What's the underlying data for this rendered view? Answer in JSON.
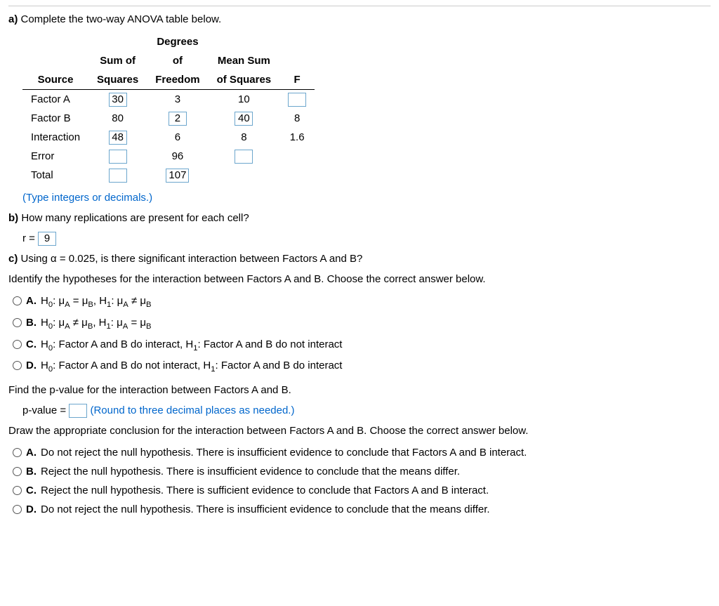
{
  "partA": {
    "prompt_prefix": "a)",
    "prompt_text": " Complete the two-way ANOVA table below.",
    "headers": {
      "source": "Source",
      "ss": "Sum of Squares",
      "ss_line1": "Sum of",
      "ss_line2": "Squares",
      "df": "Degrees of Freedom",
      "df_line1": "Degrees",
      "df_line2": "of",
      "df_line3": "Freedom",
      "ms": "Mean Sum of Squares",
      "ms_line1": "Mean Sum",
      "ms_line2": "of Squares",
      "f": "F"
    },
    "rows": {
      "factorA": {
        "label": "Factor A",
        "ss": "30",
        "df": "3",
        "ms": "10",
        "f": ""
      },
      "factorB": {
        "label": "Factor B",
        "ss": "80",
        "df": "2",
        "ms": "40",
        "f": "8"
      },
      "interaction": {
        "label": "Interaction",
        "ss": "48",
        "df": "6",
        "ms": "8",
        "f": "1.6"
      },
      "error": {
        "label": "Error",
        "ss": "",
        "df": "96",
        "ms": "",
        "f": ""
      },
      "total": {
        "label": "Total",
        "ss": "",
        "df": "107",
        "ms": "",
        "f": ""
      }
    },
    "hint": "(Type integers or decimals.)"
  },
  "partB": {
    "prompt_prefix": "b)",
    "prompt_text": " How many replications are present for each cell?",
    "var": "r = ",
    "value": "9"
  },
  "partC": {
    "prompt_prefix": "c)",
    "prompt_text": " Using α = 0.025, is there significant interaction between Factors A and B?",
    "identify": "Identify the hypotheses for the interaction between Factors A and B. Choose the correct answer below.",
    "options": {
      "A": {
        "label": "A."
      },
      "B": {
        "label": "B."
      },
      "C": {
        "label": "C.",
        "text": ": Factor A and B do interact, ",
        "text2": ": Factor A and B do not interact"
      },
      "D": {
        "label": "D.",
        "text": ": Factor A and B do not interact, ",
        "text2": ": Factor A and B do interact"
      }
    },
    "find_p": "Find the p-value for the interaction between Factors A and B.",
    "pvalue_label": "p-value = ",
    "pvalue_value": "",
    "pvalue_hint": " (Round to three decimal places as needed.)",
    "conclusion": "Draw the appropriate conclusion for the interaction between Factors A and B. Choose the correct answer below.",
    "conclusion_options": {
      "A": {
        "label": "A.",
        "text": "Do not reject the null hypothesis. There is insufficient evidence to conclude that Factors A and B interact."
      },
      "B": {
        "label": "B.",
        "text": "Reject the null hypothesis. There is insufficient evidence to conclude that the means differ."
      },
      "C": {
        "label": "C.",
        "text": "Reject the null hypothesis. There is sufficient evidence to conclude that Factors A and B interact."
      },
      "D": {
        "label": "D.",
        "text": "Do not reject the null hypothesis. There is insufficient evidence to conclude that the means differ."
      }
    }
  },
  "math": {
    "H0": "H",
    "H1": "H",
    "muA": "μ",
    "muB": "μ",
    "eq": " = ",
    "neq": " ≠ "
  }
}
